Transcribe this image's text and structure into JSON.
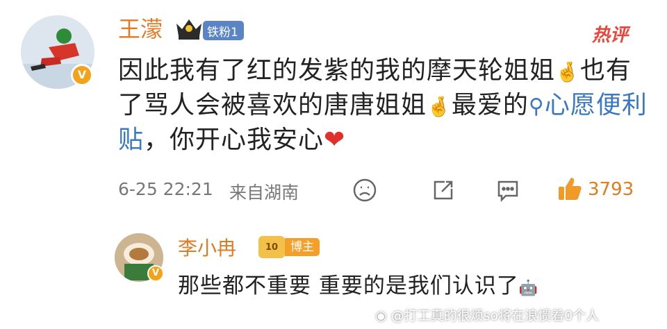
{
  "comment": {
    "username": "王濛",
    "fan_badge": "铁粉1",
    "hot_label": "热评",
    "text_part1": "因此我有了红的发紫的我的摩天轮姐姐",
    "text_part2": "也有了骂人会被喜欢的唐唐姐姐",
    "text_part3": "最爱的",
    "link_text": "心愿便利贴",
    "text_part4": "，你开心我安心",
    "timestamp": "6-25 22:21",
    "source": "来自湖南",
    "like_count": "3793",
    "verified_mark": "V"
  },
  "reply": {
    "username": "李小冉",
    "badge_level": "10",
    "badge_label": "博主",
    "text": "那些都不重要 重要的是我们认识了",
    "verified_mark": "V"
  },
  "watermark": "@打工真的很烦so将在浪惯着0个人",
  "colors": {
    "username": "#e07a24",
    "link": "#3a78c3",
    "hot": "#e8463a",
    "like": "#f09a2a",
    "fan_badge_bg": "#5b84c4",
    "blogger_badge_bg": "#f3a02a"
  }
}
